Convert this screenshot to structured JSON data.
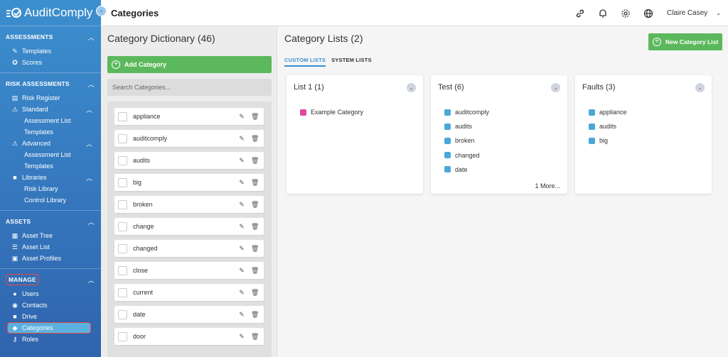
{
  "brand": {
    "name": "AuditComply"
  },
  "page": {
    "title": "Categories"
  },
  "topbar": {
    "user_name": "Claire Casey"
  },
  "sidebar": {
    "assessments": {
      "heading": "ASSESSMENTS",
      "templates": "Templates",
      "scores": "Scores"
    },
    "risk": {
      "heading": "RISK ASSESSMENTS",
      "register": "Risk Register",
      "standard": "Standard",
      "standard_assessment_list": "Assessment List",
      "standard_templates": "Templates",
      "advanced": "Advanced",
      "advanced_assessment_list": "Assessment List",
      "advanced_templates": "Templates",
      "libraries": "Libraries",
      "risk_library": "Risk Library",
      "control_library": "Control Library"
    },
    "assets": {
      "heading": "ASSETS",
      "tree": "Asset Tree",
      "list": "Asset List",
      "profiles": "Asset Profiles"
    },
    "manage": {
      "heading": "MANAGE",
      "users": "Users",
      "contacts": "Contacts",
      "drive": "Drive",
      "categories": "Categories",
      "roles": "Roles"
    }
  },
  "dictionary": {
    "title": "Category Dictionary (46)",
    "add_label": "Add Category",
    "search_placeholder": "Search Categories...",
    "items": [
      "appliance",
      "auditcomply",
      "audits",
      "big",
      "broken",
      "change",
      "changed",
      "close",
      "current",
      "date",
      "door"
    ]
  },
  "lists": {
    "title": "Category Lists (2)",
    "new_label": "New Category List",
    "tabs": [
      "CUSTOM LISTS",
      "SYSTEM LISTS"
    ],
    "cards": [
      {
        "title": "List 1 (1)",
        "items": [
          "Example Category"
        ],
        "colors": [
          "#e0499c"
        ],
        "more": ""
      },
      {
        "title": "Test (6)",
        "items": [
          "auditcomply",
          "audits",
          "broken",
          "changed",
          "date"
        ],
        "colors": [
          "#4aa8d8",
          "#4aa8d8",
          "#4aa8d8",
          "#4aa8d8",
          "#4aa8d8"
        ],
        "more": "1 More..."
      },
      {
        "title": "Faults (3)",
        "items": [
          "appliance",
          "audits",
          "big"
        ],
        "colors": [
          "#4aa8d8",
          "#4aa8d8",
          "#4aa8d8"
        ],
        "more": ""
      }
    ]
  },
  "colors": {
    "accent": "#3a8fce",
    "green": "#5cb85c",
    "highlight": "#e64a4a",
    "pink": "#e0499c",
    "blue": "#4aa8d8"
  },
  "icons": [
    "link-icon",
    "bell-icon",
    "gear-icon",
    "globe-icon",
    "chevron-down-icon",
    "pencil-icon",
    "trash-icon"
  ]
}
